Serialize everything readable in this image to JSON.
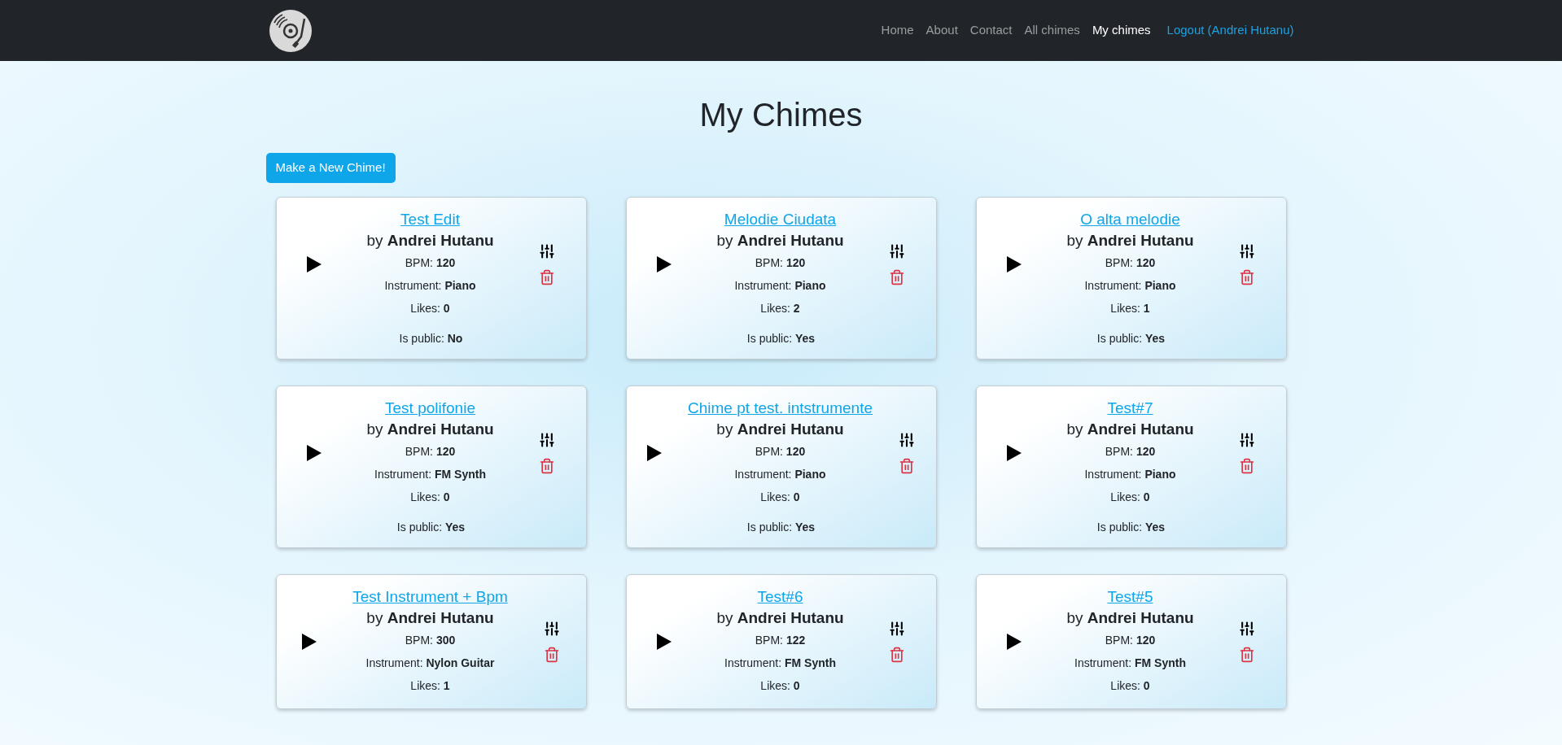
{
  "nav": {
    "links": [
      {
        "label": "Home",
        "selected": false
      },
      {
        "label": "About",
        "selected": false
      },
      {
        "label": "Contact",
        "selected": false
      },
      {
        "label": "All chimes",
        "selected": false
      },
      {
        "label": "My chimes",
        "selected": true
      }
    ],
    "logout": "Logout (Andrei Hutanu)"
  },
  "heading": "My Chimes",
  "new_button": "Make a New Chime!",
  "chimes": [
    {
      "title": "Test Edit",
      "author": "by **Andrei Hutanu**",
      "bpm": "BPM: **120**",
      "instrument": "Instrument: **Piano**",
      "likes": "Likes: **0**",
      "is_public": "Is public: **No**"
    },
    {
      "title": "Melodie Ciudata",
      "author": "by **Andrei Hutanu**",
      "bpm": "BPM: **120**",
      "instrument": "Instrument: **Piano**",
      "likes": "Likes: **2**",
      "is_public": "Is public: **Yes**"
    },
    {
      "title": "O alta melodie",
      "author": "by **Andrei Hutanu**",
      "bpm": "BPM: **120**",
      "instrument": "Instrument: **Piano**",
      "likes": "Likes: **1**",
      "is_public": "Is public: **Yes**"
    },
    {
      "title": "Test polifonie",
      "author": "by **Andrei Hutanu**",
      "bpm": "BPM: **120**",
      "instrument": "Instrument: **FM Synth**",
      "likes": "Likes: **0**",
      "is_public": "Is public: **Yes**"
    },
    {
      "title": "Chime pt test. intstrumente",
      "author": "by **Andrei Hutanu**",
      "bpm": "BPM: **120**",
      "instrument": "Instrument: **Piano**",
      "likes": "Likes: **0**",
      "is_public": "Is public: **Yes**"
    },
    {
      "title": "Test#7",
      "author": "by **Andrei Hutanu**",
      "bpm": "BPM: **120**",
      "instrument": "Instrument: **Piano**",
      "likes": "Likes: **0**",
      "is_public": "Is public: **Yes**"
    },
    {
      "title": "Test Instrument + Bpm",
      "author": "by **Andrei Hutanu**",
      "bpm": "BPM: **300**",
      "instrument": "Instrument: **Nylon Guitar**",
      "likes": "Likes: **1**"
    },
    {
      "title": "Test#6",
      "author": "by **Andrei Hutanu**",
      "bpm": "BPM: **122**",
      "instrument": "Instrument: **FM Synth**",
      "likes": "Likes: **0**"
    },
    {
      "title": "Test#5",
      "author": "by **Andrei Hutanu**",
      "bpm": "BPM: **120**",
      "instrument": "Instrument: **FM Synth**",
      "likes": "Likes: **0**"
    }
  ]
}
